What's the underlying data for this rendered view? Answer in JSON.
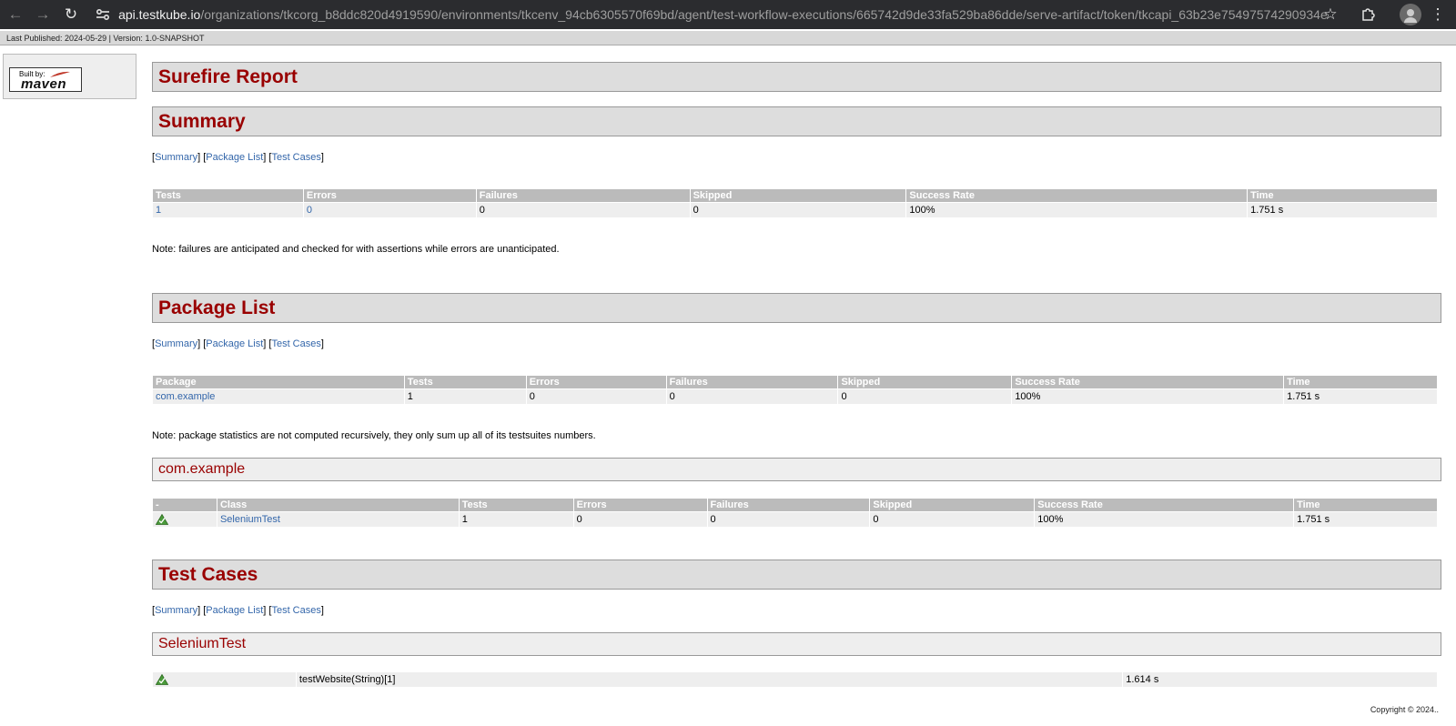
{
  "browser": {
    "url_host": "api.testkube.io",
    "url_path": "/organizations/tkcorg_b8ddc820d4919590/environments/tkcenv_94cb6305570f69bd/agent/test-workflow-executions/665742d9de33fa529ba86dde/serve-artifact/token/tkcapi_63b23e75497574290934e207a148a3/target/c..."
  },
  "banner": {
    "text": "Last Published: 2024-05-29 | Version: 1.0-SNAPSHOT"
  },
  "sidebar": {
    "built_by": "Built by:",
    "maven": "maven"
  },
  "report": {
    "title": "Surefire Report"
  },
  "nav": {
    "summary": "Summary",
    "package_list": "Package List",
    "test_cases": "Test Cases"
  },
  "summary": {
    "heading": "Summary",
    "headers": [
      "Tests",
      "Errors",
      "Failures",
      "Skipped",
      "Success Rate",
      "Time"
    ],
    "row": [
      "1",
      "0",
      "0",
      "0",
      "100%",
      "1.751 s"
    ],
    "note": "Note: failures are anticipated and checked for with assertions while errors are unanticipated."
  },
  "package_list": {
    "heading": "Package List",
    "headers": [
      "Package",
      "Tests",
      "Errors",
      "Failures",
      "Skipped",
      "Success Rate",
      "Time"
    ],
    "row": [
      "com.example",
      "1",
      "0",
      "0",
      "0",
      "100%",
      "1.751 s"
    ],
    "note": "Note: package statistics are not computed recursively, they only sum up all of its testsuites numbers."
  },
  "package_detail": {
    "heading": "com.example",
    "headers": [
      "-",
      "Class",
      "Tests",
      "Errors",
      "Failures",
      "Skipped",
      "Success Rate",
      "Time"
    ],
    "row": [
      "SeleniumTest",
      "1",
      "0",
      "0",
      "0",
      "100%",
      "1.751 s"
    ]
  },
  "test_cases": {
    "heading": "Test Cases",
    "class_heading": "SeleniumTest",
    "row": [
      "testWebsite(String)[1]",
      "1.614 s"
    ]
  },
  "footer": {
    "copyright": "Copyright © 2024.."
  }
}
